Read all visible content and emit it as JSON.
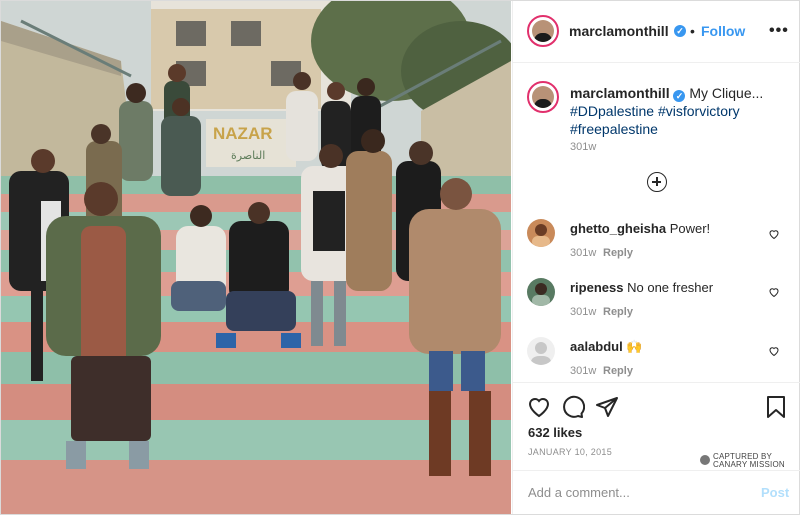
{
  "header": {
    "username": "marclamonthill",
    "dot": "•",
    "follow_label": "Follow",
    "more_label": "•••"
  },
  "caption": {
    "username": "marclamonthill",
    "text": "My Clique...",
    "hashtags": [
      "#DDpalestine",
      "#visforvictory",
      "#freepalestine"
    ],
    "time": "301w"
  },
  "photo": {
    "wall_sign": "NAZAR",
    "wall_arabic": "الناصرة"
  },
  "comments": [
    {
      "username": "ghetto_gheisha",
      "text": "Power!",
      "time": "301w",
      "reply_label": "Reply"
    },
    {
      "username": "ripeness",
      "text": "No one fresher",
      "time": "301w",
      "reply_label": "Reply"
    },
    {
      "username": "aalabdul",
      "text": "🙌",
      "time": "301w",
      "reply_label": "Reply"
    }
  ],
  "likes": "632 likes",
  "date": "JANUARY 10, 2015",
  "watermark": {
    "line1": "CAPTURED BY",
    "line2": "CANARY MISSION"
  },
  "add_comment": {
    "placeholder": "Add a comment...",
    "post_label": "Post"
  },
  "colors": {
    "link": "#3897f0",
    "hashtag": "#00376b",
    "ring": "#e1306c",
    "muted": "#8e8e8e"
  }
}
